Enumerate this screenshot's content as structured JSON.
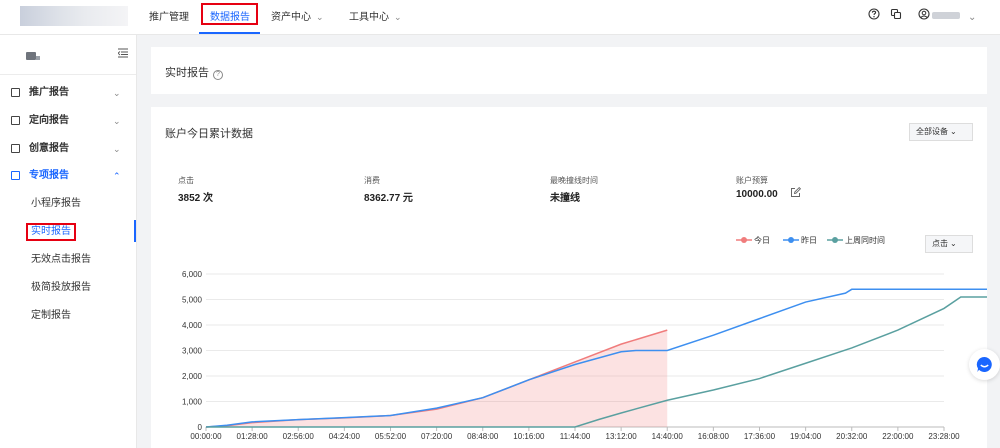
{
  "topnav": {
    "items": [
      {
        "label": "推广管理",
        "has_menu": false
      },
      {
        "label": "数据报告",
        "has_menu": false,
        "active": true
      },
      {
        "label": "资产中心",
        "has_menu": true
      },
      {
        "label": "工具中心",
        "has_menu": true
      }
    ],
    "icons": [
      "help-icon",
      "copy-icon",
      "user-icon",
      "chevron-down-icon"
    ]
  },
  "sidebar": {
    "groups": [
      {
        "label": "推广报告",
        "icon": "report-icon",
        "expanded": false
      },
      {
        "label": "定向报告",
        "icon": "report-icon",
        "expanded": false
      },
      {
        "label": "创意报告",
        "icon": "report-icon",
        "expanded": false
      },
      {
        "label": "专项报告",
        "icon": "report-icon",
        "expanded": true
      }
    ],
    "subitems": [
      {
        "label": "小程序报告"
      },
      {
        "label": "实时报告",
        "active": true
      },
      {
        "label": "无效点击报告"
      },
      {
        "label": "极简投放报告"
      },
      {
        "label": "定制报告"
      }
    ]
  },
  "page": {
    "title": "实时报告"
  },
  "summary_card": {
    "title": "账户今日累计数据",
    "device_select": "全部设备",
    "metrics": [
      {
        "label": "点击",
        "value": "3852 次"
      },
      {
        "label": "消费",
        "value": "8362.77 元"
      },
      {
        "label": "最晚撞线时间",
        "value": "未撞线"
      },
      {
        "label": "账户预算",
        "value": "10000.00"
      }
    ],
    "metric_select": "点击",
    "legend": [
      {
        "name": "今日",
        "color": "#f07c7c"
      },
      {
        "name": "昨日",
        "color": "#3d8ff0"
      },
      {
        "name": "上周同时间",
        "color": "#5aa0a0"
      }
    ]
  },
  "chart_data": {
    "type": "line",
    "title": "",
    "xlabel": "",
    "ylabel": "",
    "ylim": [
      0,
      6000
    ],
    "yticks": [
      "0",
      "1,000",
      "2,000",
      "3,000",
      "4,000",
      "5,000",
      "6,000"
    ],
    "xticks": [
      "00:00:00",
      "01:28:00",
      "02:56:00",
      "04:24:00",
      "05:52:00",
      "07:20:00",
      "08:48:00",
      "10:16:00",
      "11:44:00",
      "13:12:00",
      "14:40:00",
      "16:08:00",
      "17:36:00",
      "19:04:00",
      "20:32:00",
      "22:00:00",
      "23:28:00"
    ],
    "grid": true,
    "legend_position": "top-right",
    "x_minutes_per_tick": 88,
    "series": [
      {
        "name": "今日",
        "color": "#f07c7c",
        "fill": true,
        "x": [
          0,
          40,
          88,
          176,
          264,
          352,
          440,
          528,
          616,
          704,
          792,
          880
        ],
        "y": [
          0,
          50,
          170,
          290,
          360,
          450,
          700,
          1150,
          1850,
          2550,
          3250,
          3800
        ]
      },
      {
        "name": "昨日",
        "color": "#3d8ff0",
        "fill": false,
        "x": [
          0,
          40,
          88,
          176,
          264,
          352,
          440,
          528,
          616,
          704,
          792,
          820,
          880,
          968,
          1056,
          1144,
          1220,
          1232,
          1320,
          1408,
          1496,
          1584
        ],
        "y": [
          0,
          70,
          200,
          290,
          370,
          450,
          740,
          1150,
          1850,
          2450,
          2950,
          3000,
          3000,
          3600,
          4250,
          4900,
          5250,
          5400,
          5400,
          5400,
          5400,
          5400
        ]
      },
      {
        "name": "上周同时间",
        "color": "#5aa0a0",
        "fill": false,
        "x": [
          0,
          704,
          750,
          792,
          880,
          968,
          1056,
          1144,
          1232,
          1320,
          1408,
          1440,
          1496,
          1584
        ],
        "y": [
          0,
          0,
          300,
          550,
          1050,
          1450,
          1900,
          2500,
          3100,
          3800,
          4650,
          5100,
          5100,
          5100
        ]
      }
    ]
  }
}
